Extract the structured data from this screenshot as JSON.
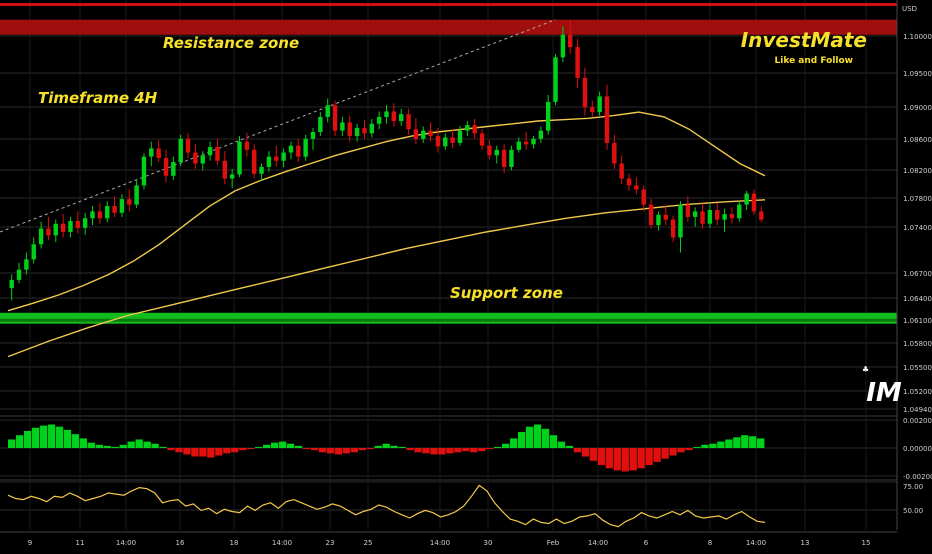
{
  "chart_data": [
    {
      "type": "candlestick",
      "currency_label": "USD",
      "price_ticks": [
        "1.10000",
        "1.09500",
        "1.09000",
        "1.08600",
        "1.08200",
        "1.07800",
        "1.07400",
        "1.06700",
        "1.06400",
        "1.06100",
        "1.05800",
        "1.05500",
        "1.05200",
        "1.04940"
      ],
      "x_ticks": [
        "9",
        "11",
        "14:00",
        "16",
        "18",
        "14:00",
        "23",
        "25",
        "14:00",
        "30",
        "Feb",
        "14:00",
        "6",
        "8",
        "14:00",
        "13",
        "15"
      ],
      "ylim": [
        1.047,
        1.106
      ],
      "candles": [
        [
          1.0648,
          1.0668,
          1.063,
          1.066
        ],
        [
          1.066,
          1.0685,
          1.0655,
          1.0675
        ],
        [
          1.0675,
          1.07,
          1.0668,
          1.069
        ],
        [
          1.069,
          1.0722,
          1.0684,
          1.0712
        ],
        [
          1.0712,
          1.0745,
          1.0706,
          1.0735
        ],
        [
          1.0735,
          1.0752,
          1.0718,
          1.0725
        ],
        [
          1.0725,
          1.0748,
          1.0715,
          1.0742
        ],
        [
          1.0742,
          1.0756,
          1.0722,
          1.073
        ],
        [
          1.073,
          1.0752,
          1.0722,
          1.0746
        ],
        [
          1.0746,
          1.076,
          1.0728,
          1.0736
        ],
        [
          1.0736,
          1.0758,
          1.0726,
          1.075
        ],
        [
          1.075,
          1.0768,
          1.074,
          1.076
        ],
        [
          1.076,
          1.0772,
          1.0742,
          1.075
        ],
        [
          1.075,
          1.0775,
          1.0744,
          1.0768
        ],
        [
          1.0768,
          1.0782,
          1.0752,
          1.0758
        ],
        [
          1.0758,
          1.0785,
          1.0752,
          1.0778
        ],
        [
          1.0778,
          1.0792,
          1.076,
          1.077
        ],
        [
          1.077,
          1.0805,
          1.0765,
          1.0798
        ],
        [
          1.0798,
          1.0845,
          1.0792,
          1.084
        ],
        [
          1.084,
          1.0862,
          1.0826,
          1.0852
        ],
        [
          1.0852,
          1.0864,
          1.0832,
          1.0838
        ],
        [
          1.0838,
          1.085,
          1.0802,
          1.0812
        ],
        [
          1.0812,
          1.084,
          1.0806,
          1.0832
        ],
        [
          1.0832,
          1.0872,
          1.0826,
          1.0866
        ],
        [
          1.0866,
          1.0874,
          1.0838,
          1.0846
        ],
        [
          1.0846,
          1.0858,
          1.0822,
          1.083
        ],
        [
          1.083,
          1.0848,
          1.082,
          1.0842
        ],
        [
          1.0842,
          1.0862,
          1.0834,
          1.0854
        ],
        [
          1.0854,
          1.0866,
          1.0828,
          1.0834
        ],
        [
          1.0834,
          1.0848,
          1.08,
          1.0808
        ],
        [
          1.0808,
          1.0822,
          1.0794,
          1.0814
        ],
        [
          1.0814,
          1.087,
          1.081,
          1.0862
        ],
        [
          1.0862,
          1.0875,
          1.084,
          1.085
        ],
        [
          1.085,
          1.0858,
          1.0808,
          1.0815
        ],
        [
          1.0815,
          1.083,
          1.0805,
          1.0825
        ],
        [
          1.0825,
          1.0848,
          1.0818,
          1.084
        ],
        [
          1.084,
          1.0856,
          1.0826,
          1.0834
        ],
        [
          1.0834,
          1.0852,
          1.0824,
          1.0846
        ],
        [
          1.0846,
          1.0862,
          1.0836,
          1.0856
        ],
        [
          1.0856,
          1.0866,
          1.0832,
          1.084
        ],
        [
          1.084,
          1.0872,
          1.0834,
          1.0866
        ],
        [
          1.0866,
          1.0882,
          1.085,
          1.0876
        ],
        [
          1.0876,
          1.0905,
          1.087,
          1.0898
        ],
        [
          1.0898,
          1.0925,
          1.089,
          1.0915
        ],
        [
          1.0915,
          1.0922,
          1.087,
          1.0878
        ],
        [
          1.0878,
          1.0898,
          1.087,
          1.089
        ],
        [
          1.089,
          1.09,
          1.0862,
          1.087
        ],
        [
          1.087,
          1.0888,
          1.0862,
          1.0882
        ],
        [
          1.0882,
          1.0894,
          1.0866,
          1.0874
        ],
        [
          1.0874,
          1.0895,
          1.0868,
          1.0888
        ],
        [
          1.0888,
          1.0906,
          1.088,
          1.0898
        ],
        [
          1.0898,
          1.0915,
          1.0888,
          1.0906
        ],
        [
          1.0906,
          1.0918,
          1.0884,
          1.0892
        ],
        [
          1.0892,
          1.091,
          1.0885,
          1.0902
        ],
        [
          1.0902,
          1.091,
          1.0872,
          1.088
        ],
        [
          1.088,
          1.0896,
          1.0858,
          1.0866
        ],
        [
          1.0866,
          1.0884,
          1.086,
          1.0878
        ],
        [
          1.0878,
          1.089,
          1.0862,
          1.087
        ],
        [
          1.087,
          1.0882,
          1.0846,
          1.0855
        ],
        [
          1.0855,
          1.0874,
          1.085,
          1.0868
        ],
        [
          1.0868,
          1.088,
          1.0852,
          1.086
        ],
        [
          1.086,
          1.0885,
          1.0856,
          1.0878
        ],
        [
          1.0878,
          1.0892,
          1.087,
          1.0886
        ],
        [
          1.0886,
          1.0895,
          1.0866,
          1.0874
        ],
        [
          1.0874,
          1.088,
          1.085,
          1.0856
        ],
        [
          1.0856,
          1.0864,
          1.0836,
          1.0842
        ],
        [
          1.0842,
          1.0856,
          1.083,
          1.085
        ],
        [
          1.085,
          1.0858,
          1.0816,
          1.0825
        ],
        [
          1.0825,
          1.0856,
          1.082,
          1.085
        ],
        [
          1.085,
          1.0868,
          1.0846,
          1.0862
        ],
        [
          1.0862,
          1.0876,
          1.085,
          1.0858
        ],
        [
          1.0858,
          1.087,
          1.0852,
          1.0866
        ],
        [
          1.0866,
          1.0884,
          1.086,
          1.0878
        ],
        [
          1.0878,
          1.093,
          1.0872,
          1.092
        ],
        [
          1.092,
          1.099,
          1.0915,
          1.0985
        ],
        [
          1.0985,
          1.103,
          1.0978,
          1.1018
        ],
        [
          1.1018,
          1.104,
          1.099,
          1.1
        ],
        [
          1.1,
          1.1012,
          1.094,
          1.0955
        ],
        [
          1.0955,
          1.097,
          1.09,
          1.0912
        ],
        [
          1.0912,
          1.0922,
          1.0898,
          1.0905
        ],
        [
          1.0905,
          1.0935,
          1.09,
          1.0928
        ],
        [
          1.0928,
          1.0945,
          1.085,
          1.086
        ],
        [
          1.086,
          1.0872,
          1.0822,
          1.083
        ],
        [
          1.083,
          1.0842,
          1.08,
          1.0808
        ],
        [
          1.0808,
          1.0815,
          1.079,
          1.0798
        ],
        [
          1.0798,
          1.081,
          1.0785,
          1.0792
        ],
        [
          1.0792,
          1.0798,
          1.076,
          1.077
        ],
        [
          1.077,
          1.0778,
          1.0735,
          1.074
        ],
        [
          1.074,
          1.076,
          1.0732,
          1.0755
        ],
        [
          1.0755,
          1.077,
          1.074,
          1.0748
        ],
        [
          1.0748,
          1.0754,
          1.0715,
          1.0722
        ],
        [
          1.0722,
          1.0775,
          1.07,
          1.077
        ],
        [
          1.077,
          1.0782,
          1.0745,
          1.0752
        ],
        [
          1.0752,
          1.0766,
          1.0738,
          1.076
        ],
        [
          1.076,
          1.0772,
          1.0735,
          1.0742
        ],
        [
          1.0742,
          1.077,
          1.0736,
          1.0762
        ],
        [
          1.0762,
          1.0772,
          1.074,
          1.0748
        ],
        [
          1.0748,
          1.0764,
          1.073,
          1.0756
        ],
        [
          1.0756,
          1.0766,
          1.0742,
          1.075
        ],
        [
          1.075,
          1.0775,
          1.0745,
          1.077
        ],
        [
          1.077,
          1.079,
          1.0762,
          1.0786
        ],
        [
          1.0786,
          1.0792,
          1.0755,
          1.076
        ],
        [
          1.076,
          1.0768,
          1.0744,
          1.0748
        ]
      ],
      "ema_fast": [
        1.0615,
        1.0626,
        1.0638,
        1.0652,
        1.0668,
        1.0688,
        1.0712,
        1.074,
        1.0768,
        1.079,
        1.0805,
        1.0818,
        1.083,
        1.0842,
        1.0852,
        1.0862,
        1.087,
        1.0876,
        1.088,
        1.0884,
        1.0888,
        1.0892,
        1.0894,
        1.0896,
        1.09,
        1.0905,
        1.0898,
        1.088,
        1.0855,
        1.083,
        1.0812
      ],
      "ema_slow": [
        1.0548,
        1.057,
        1.059,
        1.0608,
        1.0622,
        1.0636,
        1.065,
        1.0664,
        1.0678,
        1.0692,
        1.0706,
        1.0718,
        1.073,
        1.074,
        1.075,
        1.0758,
        1.0764,
        1.077,
        1.0774,
        1.0777
      ],
      "resistance_zone": [
        1.1018,
        1.104
      ],
      "support_zone": [
        1.0596,
        1.0612
      ],
      "annotations": [
        "Resistance zone",
        "Timeframe 4H",
        "Support zone"
      ]
    },
    {
      "type": "bar",
      "y_ticks": [
        "0.00200",
        "0.00000",
        "-0.00200"
      ],
      "ylim": [
        -0.003,
        0.003
      ],
      "values": [
        0.0008,
        0.0012,
        0.0016,
        0.0019,
        0.0021,
        0.0022,
        0.002,
        0.0017,
        0.0013,
        0.0009,
        0.0005,
        0.0003,
        0.0002,
        0.0001,
        0.0003,
        0.0006,
        0.0008,
        0.0006,
        0.0004,
        0.0001,
        -0.0002,
        -0.0004,
        -0.0006,
        -0.0008,
        -0.0008,
        -0.0009,
        -0.0007,
        -0.0005,
        -0.0004,
        -0.0002,
        -0.0001,
        0.0001,
        0.0003,
        0.0005,
        0.0006,
        0.0004,
        0.0002,
        -0.0001,
        -0.0002,
        -0.0004,
        -0.0005,
        -0.0006,
        -0.0005,
        -0.0004,
        -0.0002,
        -0.0001,
        0.0002,
        0.0004,
        0.0002,
        0.0001,
        -0.0002,
        -0.0004,
        -0.0005,
        -0.0006,
        -0.0006,
        -0.0005,
        -0.0004,
        -0.0003,
        -0.0004,
        -0.0003,
        -0.0001,
        0.0001,
        0.0004,
        0.0009,
        0.0015,
        0.002,
        0.0022,
        0.0018,
        0.0012,
        0.0006,
        0.0002,
        -0.0004,
        -0.0008,
        -0.0012,
        -0.0016,
        -0.0019,
        -0.0021,
        -0.0022,
        -0.0021,
        -0.0019,
        -0.0016,
        -0.0013,
        -0.001,
        -0.0007,
        -0.0004,
        -0.0002,
        0.0001,
        0.0003,
        0.0004,
        0.0006,
        0.0008,
        0.001,
        0.0012,
        0.0011,
        0.0009
      ]
    },
    {
      "type": "line",
      "y_ticks": [
        "75.00",
        "50.00"
      ],
      "ylim": [
        38,
        84
      ],
      "values": [
        70,
        67,
        66,
        69,
        67,
        64,
        69,
        68,
        72,
        69,
        65,
        67,
        69,
        72,
        71,
        70,
        74,
        77,
        76,
        72,
        63,
        65,
        66,
        60,
        62,
        56,
        58,
        53,
        57,
        55,
        54,
        60,
        56,
        61,
        63,
        58,
        64,
        66,
        63,
        60,
        57,
        59,
        62,
        60,
        56,
        52,
        55,
        57,
        61,
        59,
        55,
        52,
        49,
        53,
        56,
        54,
        50,
        52,
        55,
        60,
        69,
        79,
        74,
        63,
        55,
        48,
        46,
        43,
        48,
        45,
        44,
        48,
        44,
        46,
        50,
        51,
        53,
        47,
        43,
        41,
        46,
        49,
        54,
        51,
        49,
        52,
        55,
        52,
        56,
        51,
        49,
        50,
        51,
        48,
        52,
        55,
        50,
        46,
        45
      ]
    }
  ],
  "branding": {
    "title": "InvestMate",
    "subtitle": "Like and Follow",
    "logo_text": "IM"
  },
  "colors": {
    "up": "#00d21b",
    "down": "#e0100f",
    "ema": "#f2c94c",
    "annotation": "#f7e02b",
    "resistance": "#b30f0f",
    "support": "#13c61f"
  }
}
